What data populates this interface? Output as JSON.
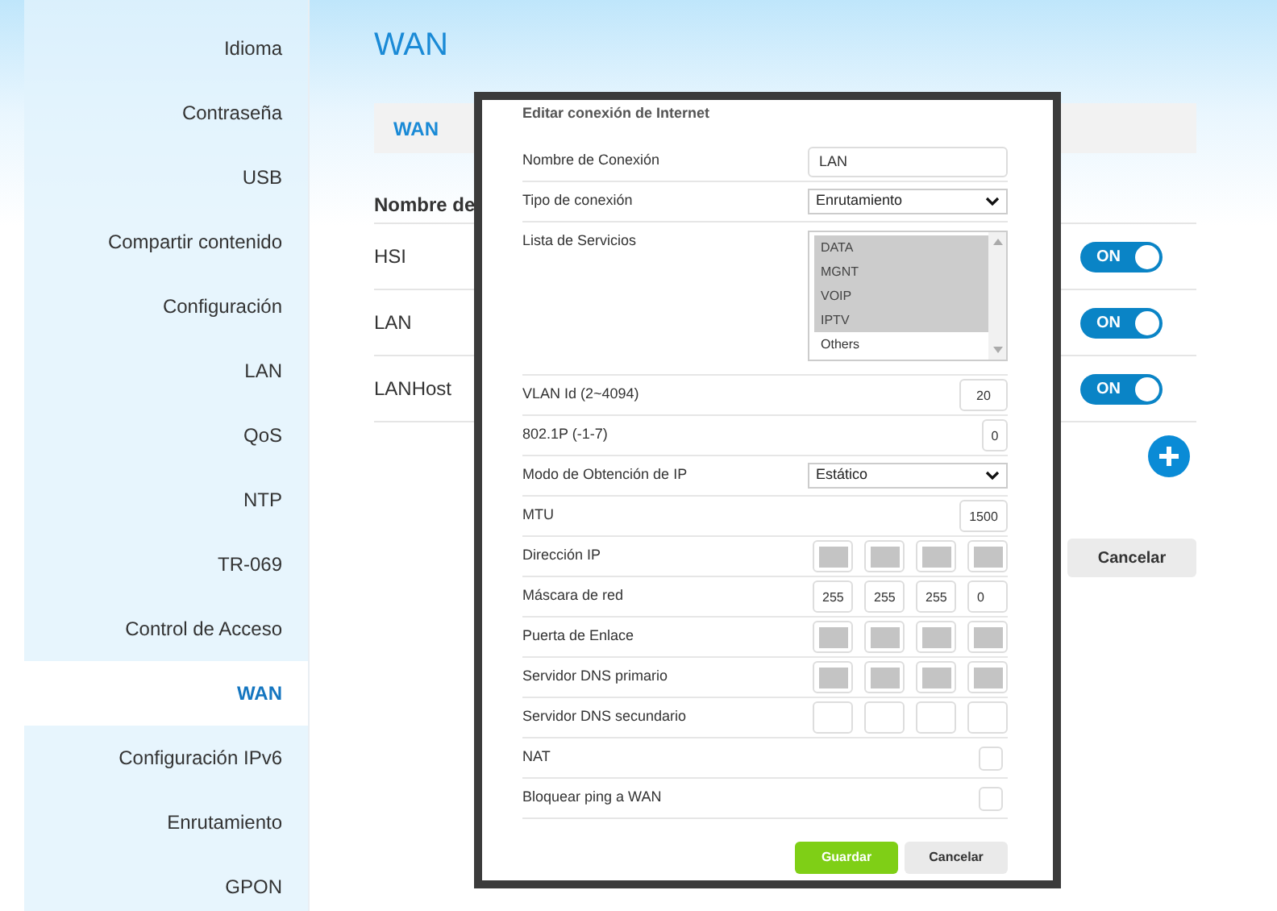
{
  "sidebar": {
    "items": [
      {
        "label": "Idioma",
        "selected": false
      },
      {
        "label": "Contraseña",
        "selected": false
      },
      {
        "label": "USB",
        "selected": false
      },
      {
        "label": "Compartir contenido",
        "selected": false
      },
      {
        "label": "Configuración",
        "selected": false
      },
      {
        "label": "LAN",
        "selected": false
      },
      {
        "label": "QoS",
        "selected": false
      },
      {
        "label": "NTP",
        "selected": false
      },
      {
        "label": "TR-069",
        "selected": false
      },
      {
        "label": "Control de Acceso",
        "selected": false
      },
      {
        "label": "WAN",
        "selected": true
      },
      {
        "label": "Configuración IPv6",
        "selected": false
      },
      {
        "label": "Enrutamiento",
        "selected": false
      },
      {
        "label": "GPON",
        "selected": false
      }
    ]
  },
  "page": {
    "title": "WAN",
    "tabs": [
      {
        "label": "WAN",
        "selected": true
      }
    ],
    "table": {
      "column_1": "Nombre de",
      "rows": [
        {
          "name": "HSI",
          "toggle": "ON",
          "on": true
        },
        {
          "name": "LAN",
          "toggle": "ON",
          "on": true
        },
        {
          "name": "LANHost",
          "toggle": "ON",
          "on": true
        }
      ]
    },
    "cancel_button": "Cancelar"
  },
  "dialog": {
    "title": "Editar conexión de Internet",
    "fields": [
      {
        "kind": "text",
        "label": "Nombre de Conexión",
        "value": "LAN"
      },
      {
        "kind": "select",
        "label": "Tipo de conexión",
        "value": "Enrutamiento"
      },
      {
        "kind": "list",
        "label": "Lista de Servicios",
        "options": [
          {
            "label": "DATA",
            "selected": true
          },
          {
            "label": "MGNT",
            "selected": true
          },
          {
            "label": "VOIP",
            "selected": true
          },
          {
            "label": "IPTV",
            "selected": true
          },
          {
            "label": "Others",
            "selected": false
          }
        ]
      },
      {
        "kind": "short",
        "label": "VLAN Id (2~4094)",
        "value": "20"
      },
      {
        "kind": "tiny",
        "label": "802.1P (-1-7)",
        "value": "0"
      },
      {
        "kind": "select",
        "label": "Modo de Obtención de IP",
        "value": "Estático"
      },
      {
        "kind": "short",
        "label": "MTU",
        "value": "1500"
      },
      {
        "kind": "ip",
        "label": "Dirección IP",
        "octets": [
          {
            "redacted": true
          },
          {
            "redacted": true
          },
          {
            "redacted": true
          },
          {
            "redacted": true
          }
        ]
      },
      {
        "kind": "ip",
        "label": "Máscara de red",
        "octets": [
          {
            "value": "255"
          },
          {
            "value": "255"
          },
          {
            "value": "255"
          },
          {
            "value": "0"
          }
        ]
      },
      {
        "kind": "ip",
        "label": "Puerta de Enlace",
        "octets": [
          {
            "redacted": true
          },
          {
            "redacted": true
          },
          {
            "redacted": true
          },
          {
            "redacted": true
          }
        ]
      },
      {
        "kind": "ip",
        "label": "Servidor DNS primario",
        "octets": [
          {
            "redacted": true
          },
          {
            "redacted": true
          },
          {
            "redacted": true
          },
          {
            "redacted": true
          }
        ]
      },
      {
        "kind": "ip",
        "label": "Servidor DNS secundario",
        "octets": [
          {
            "redacted": false
          },
          {
            "redacted": false
          },
          {
            "redacted": false
          },
          {
            "redacted": false
          }
        ]
      },
      {
        "kind": "checkbox",
        "label": "NAT",
        "checked": false
      },
      {
        "kind": "checkbox",
        "label": "Bloquear ping a WAN",
        "checked": false
      }
    ],
    "buttons": [
      {
        "label": "Guardar",
        "kind": "primary"
      },
      {
        "label": "Cancelar",
        "kind": "secondary"
      }
    ]
  }
}
